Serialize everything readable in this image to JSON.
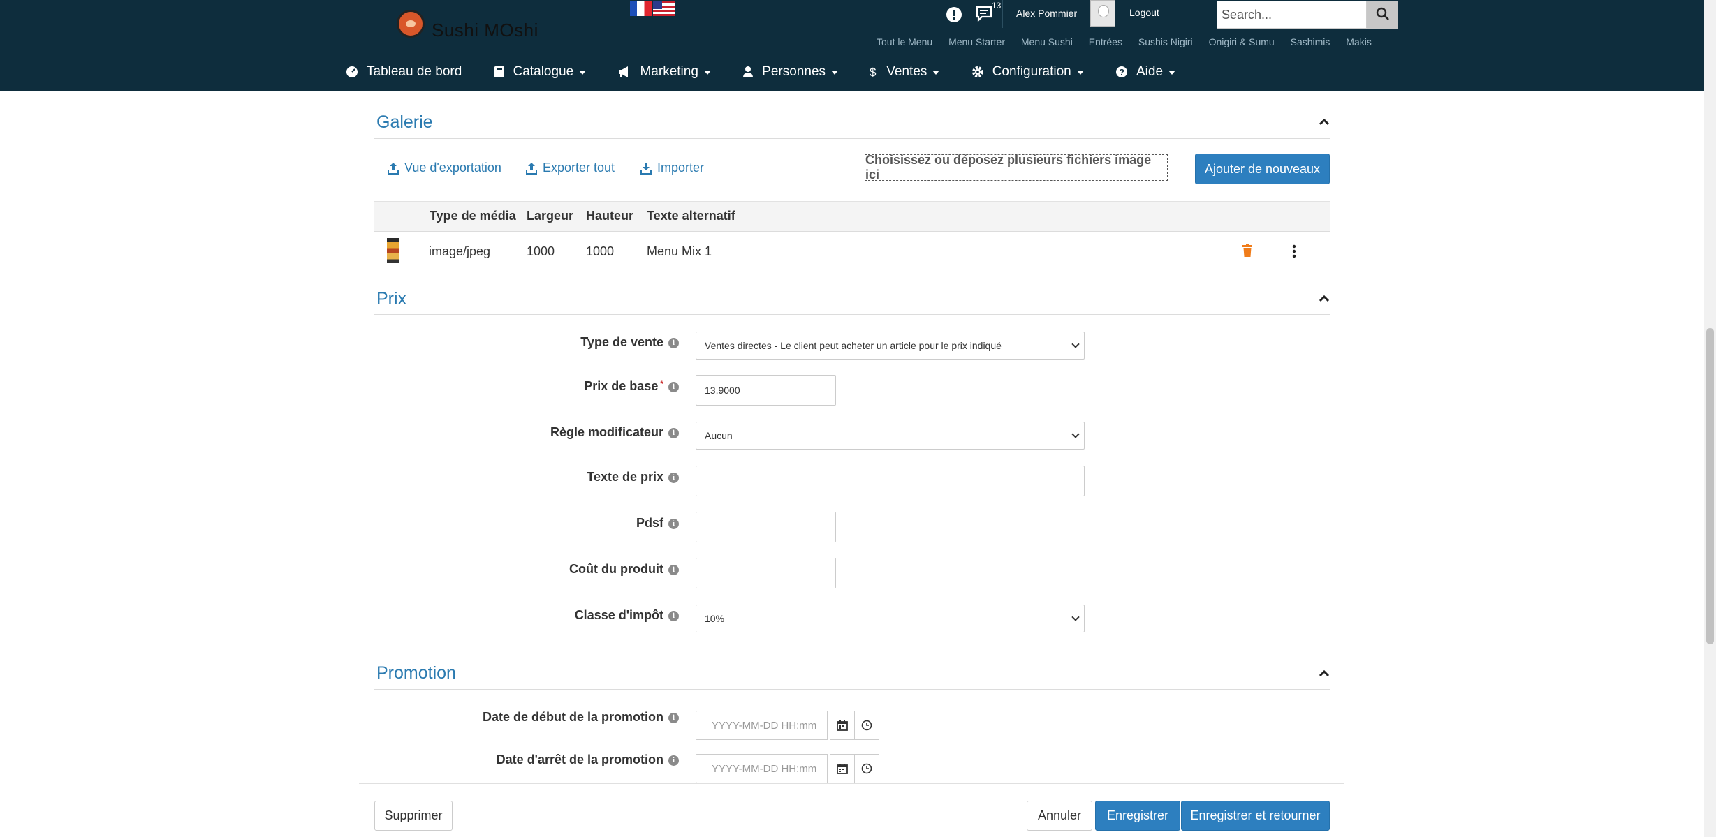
{
  "header": {
    "logo_text": "Sushi MOshi",
    "notif_count": "13",
    "user_name": "Alex Pommier",
    "logout": "Logout",
    "search_placeholder": "Search...",
    "quick_links": [
      "Tout le Menu",
      "Menu Starter",
      "Menu Sushi",
      "Entrées",
      "Sushis Nigiri",
      "Onigiri & Sumu",
      "Sashimis",
      "Makis"
    ],
    "nav": [
      {
        "label": "Tableau de bord",
        "icon": "dashboard-icon"
      },
      {
        "label": "Catalogue",
        "icon": "book-icon"
      },
      {
        "label": "Marketing",
        "icon": "megaphone-icon"
      },
      {
        "label": "Personnes",
        "icon": "user-icon"
      },
      {
        "label": "Ventes",
        "icon": "dollar-icon"
      },
      {
        "label": "Configuration",
        "icon": "gear-icon"
      },
      {
        "label": "Aide",
        "icon": "question-icon"
      }
    ]
  },
  "gallery": {
    "title": "Galerie",
    "export_view": "Vue d'exportation",
    "export_all": "Exporter tout",
    "import": "Importer",
    "dropzone": "Choisissez ou déposez plusieurs fichiers image ici",
    "add_new": "Ajouter de nouveaux",
    "columns": [
      "Type de média",
      "Largeur",
      "Hauteur",
      "Texte alternatif"
    ],
    "rows": [
      {
        "type": "image/jpeg",
        "width": "1000",
        "height": "1000",
        "alt": "Menu Mix 1"
      }
    ]
  },
  "prix": {
    "title": "Prix",
    "sale_type_label": "Type de vente",
    "sale_type_value": "Ventes directes - Le client peut acheter un article pour le prix indiqué",
    "base_price_label": "Prix de base",
    "base_price_value": "13,9000",
    "modifier_label": "Règle modificateur",
    "modifier_value": "Aucun",
    "price_text_label": "Texte de prix",
    "pdsf_label": "Pdsf",
    "cost_label": "Coût du produit",
    "tax_label": "Classe d'impôt",
    "tax_value": "10%"
  },
  "promotion": {
    "title": "Promotion",
    "start_label": "Date de début de la promotion",
    "end_label": "Date d'arrêt de la promotion",
    "date_placeholder": "YYYY-MM-DD HH:mm"
  },
  "footer": {
    "delete": "Supprimer",
    "cancel": "Annuler",
    "save": "Enregistrer",
    "save_return": "Enregistrer et retourner"
  },
  "colors": {
    "header_bg": "#0e2d3d",
    "accent": "#2d7fbf",
    "link": "#2a7ab0",
    "delete_icon": "#f07c1a"
  }
}
